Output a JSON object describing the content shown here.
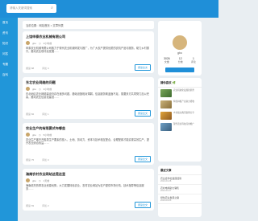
{
  "search": {
    "placeholder": "请输入关键词搜索"
  },
  "sidebar": {
    "items": [
      {
        "label": "首页"
      },
      {
        "label": "资讯"
      },
      {
        "label": "知识"
      },
      {
        "label": "问答"
      },
      {
        "label": "专题"
      },
      {
        "label": "百科"
      }
    ]
  },
  "breadcrumb": {
    "text": "当前位置：网站首页 > 文章列表"
  },
  "articles": [
    {
      "title": "上饶申泰农业机械有限公司",
      "author": "gbo",
      "time": "2小时前",
      "desc": "申泰农业机械有限公司致力于现代农业机械研发与推广，为广大农户提供优质的农机产品与服务，助力乡村振兴，推动农业现代化发展……",
      "views": "阅读 88",
      "comments": "评论 0",
      "more": "阅读全文"
    },
    {
      "title": "东北农业网络的问题",
      "author": "gbo",
      "time": "3小时前",
      "desc": "东北地区农业网络建设仍存在诸多问题，基础设施相对薄弱，信息服务覆盖面不足，需要多方共同努力加以完善，推动农业信息化建设……",
      "views": "阅读 82",
      "comments": "评论 1",
      "more": "阅读全文"
    },
    {
      "title": "农业生产的有限要式布哪些",
      "author": "gbo",
      "time": "5小时前",
      "desc": "农业生产离不开各类生产要素的投入，土地、劳动力、资本与技术相互配合，合理配置才能实现高效生产，提升农业综合效益……",
      "views": "阅读 75",
      "comments": "评论 0",
      "more": "阅读全文"
    },
    {
      "title": "海南农村农业网站这是这里",
      "author": "gbo",
      "time": "1天前",
      "desc": "海南依托热带农业资源优势，大力发展特色农业，农村农业网站为农户提供市场行情、技术指导等信息服务……",
      "views": "阅读 69",
      "comments": "评论 2",
      "more": "阅读全文"
    }
  ],
  "profile": {
    "name": "gbo",
    "stats": [
      {
        "num": "3026",
        "label": "文章"
      },
      {
        "num": "12",
        "label": "分类"
      },
      {
        "num": "1",
        "label": "评论"
      }
    ]
  },
  "hot": {
    "title": "猜你喜欢",
    "tag": "🌿",
    "items": [
      {
        "text": "农业机械化发展新趋势"
      },
      {
        "text": "特色种植产业助力增收"
      },
      {
        "text": "乡村振兴典型案例分享"
      },
      {
        "text": "现代农业科技应用推广"
      }
    ]
  },
  "recent": {
    "title": "最近文章",
    "items": [
      {
        "text": "农业合作社发展经验",
        "date": "2024-03-28"
      },
      {
        "text": "农村电商助力销售",
        "date": "2024-03-27"
      },
      {
        "text": "绿色农业发展之路",
        "date": "2024-03-26"
      }
    ]
  },
  "colors": {
    "header": "#1f8fd8",
    "sidebar": "#2196d9",
    "page_bg": "#e9eef2"
  }
}
